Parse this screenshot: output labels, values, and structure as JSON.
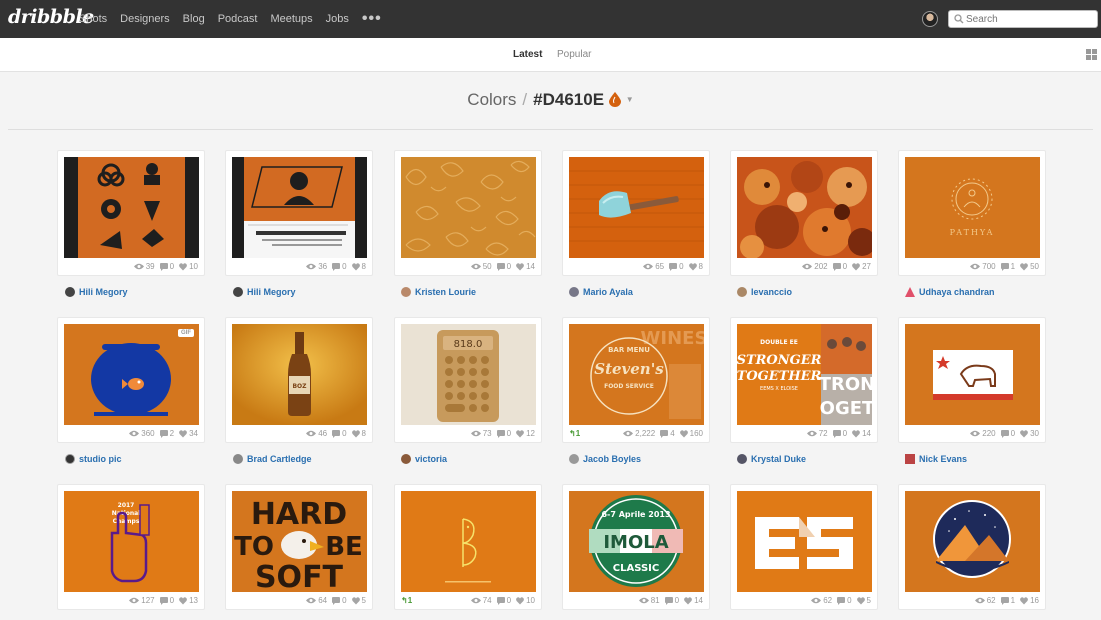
{
  "topnav": {
    "logo": "dribbble",
    "items": [
      "Shots",
      "Designers",
      "Blog",
      "Podcast",
      "Meetups",
      "Jobs"
    ],
    "more": "•••",
    "search_placeholder": "Search"
  },
  "subnav": {
    "tabs": [
      "Latest",
      "Popular"
    ]
  },
  "heading": {
    "prefix": "Colors",
    "separator": "/",
    "hex": "#D4610E",
    "accent": "#D4610E"
  },
  "shots": [
    {
      "author": "Hili Megory",
      "views": "39",
      "comments": "0",
      "likes": "10"
    },
    {
      "author": "Hili Megory",
      "views": "36",
      "comments": "0",
      "likes": "8"
    },
    {
      "author": "Kristen Lourie",
      "views": "50",
      "comments": "0",
      "likes": "14"
    },
    {
      "author": "Mario Ayala",
      "views": "65",
      "comments": "0",
      "likes": "8"
    },
    {
      "author": "levanccio",
      "views": "202",
      "comments": "0",
      "likes": "27"
    },
    {
      "author": "Udhaya chandran",
      "views": "700",
      "comments": "1",
      "likes": "50"
    },
    {
      "author": "studio pic",
      "views": "360",
      "comments": "2",
      "likes": "34",
      "badge": "GIF"
    },
    {
      "author": "Brad Cartledge",
      "views": "46",
      "comments": "0",
      "likes": "8"
    },
    {
      "author": "victoria",
      "views": "73",
      "comments": "0",
      "likes": "12"
    },
    {
      "author": "Jacob Boyles",
      "views": "2,222",
      "comments": "4",
      "likes": "160",
      "rebounds": "1"
    },
    {
      "author": "Krystal Duke",
      "views": "72",
      "comments": "0",
      "likes": "14"
    },
    {
      "author": "Nick Evans",
      "views": "220",
      "comments": "0",
      "likes": "30"
    },
    {
      "author": "",
      "views": "127",
      "comments": "0",
      "likes": "13"
    },
    {
      "author": "",
      "views": "64",
      "comments": "0",
      "likes": "5"
    },
    {
      "author": "",
      "views": "74",
      "comments": "0",
      "likes": "10",
      "rebounds": "1"
    },
    {
      "author": "",
      "views": "81",
      "comments": "0",
      "likes": "14"
    },
    {
      "author": "",
      "views": "62",
      "comments": "0",
      "likes": "5"
    },
    {
      "author": "",
      "views": "62",
      "comments": "1",
      "likes": "16"
    }
  ],
  "thumb_text": {
    "calc_display": "818.0",
    "bottle_label": "BOZ",
    "bar_menu": "BAR MENU",
    "stevens": "Steven's",
    "food_service": "FOOD SERVICE",
    "wines": "WINES",
    "stronger": "DOUBLE EE",
    "stronger_main": "STRONGER",
    "together": "TOGETHER",
    "stronger_names": "EEMS X ELOISE",
    "stronger_side_top": "TRON",
    "stronger_side_bottom": "OGET",
    "pathya": "PATHYA",
    "champs_year": "2017",
    "champs_line1": "National",
    "champs_line2": "Champs",
    "hard": "HARD",
    "to": "TO",
    "be": "BE",
    "soft": "SOFT",
    "imola_date": "6-7 Aprile 2013",
    "imola": "IMOLA",
    "classic": "CLASSIC"
  }
}
